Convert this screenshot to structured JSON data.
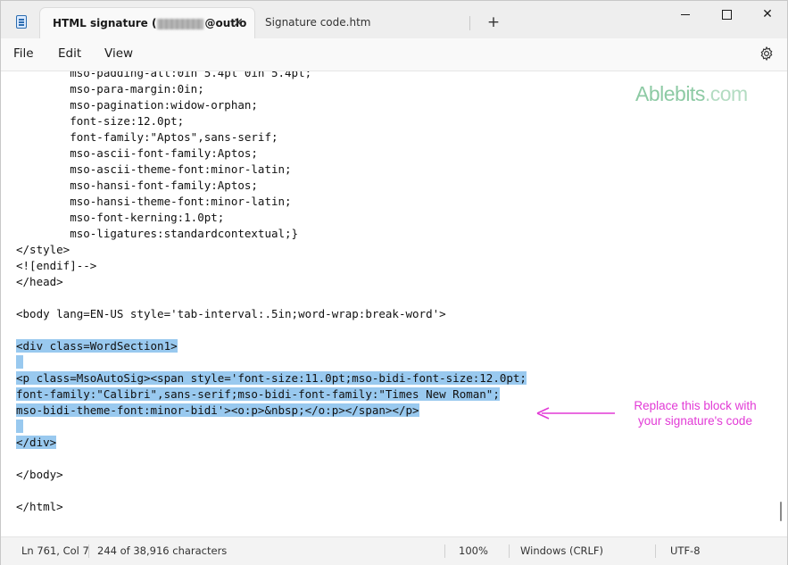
{
  "window": {
    "tabs": [
      {
        "label_prefix": "HTML signature (",
        "label_suffix": "@outlo",
        "active": true
      },
      {
        "label": "Signature code.htm",
        "active": false
      }
    ],
    "tab_close_glyph": "✕",
    "new_tab_glyph": "+",
    "close_glyph": "✕"
  },
  "menu": {
    "file": "File",
    "edit": "Edit",
    "view": "View"
  },
  "editor": {
    "lines": [
      {
        "text": "        mso-padding-alt:0in 5.4pt 0in 5.4pt;"
      },
      {
        "text": "        mso-para-margin:0in;"
      },
      {
        "text": "        mso-pagination:widow-orphan;"
      },
      {
        "text": "        font-size:12.0pt;"
      },
      {
        "text": "        font-family:\"Aptos\",sans-serif;"
      },
      {
        "text": "        mso-ascii-font-family:Aptos;"
      },
      {
        "text": "        mso-ascii-theme-font:minor-latin;"
      },
      {
        "text": "        mso-hansi-font-family:Aptos;"
      },
      {
        "text": "        mso-hansi-theme-font:minor-latin;"
      },
      {
        "text": "        mso-font-kerning:1.0pt;"
      },
      {
        "text": "        mso-ligatures:standardcontextual;}"
      },
      {
        "text": "</style>"
      },
      {
        "text": "<![endif]-->"
      },
      {
        "text": "</head>"
      },
      {
        "text": ""
      },
      {
        "text": "<body lang=EN-US style='tab-interval:.5in;word-wrap:break-word'>"
      },
      {
        "text": ""
      },
      {
        "text": "<div class=WordSection1>",
        "selected": true
      },
      {
        "text": " ",
        "selected": true
      },
      {
        "text": "<p class=MsoAutoSig><span style='font-size:11.0pt;mso-bidi-font-size:12.0pt;",
        "selected": true
      },
      {
        "text": "font-family:\"Calibri\",sans-serif;mso-bidi-font-family:\"Times New Roman\";",
        "selected": true
      },
      {
        "text": "mso-bidi-theme-font:minor-bidi'><o:p>&nbsp;</o:p></span></p>",
        "selected": true
      },
      {
        "text": " ",
        "selected": true
      },
      {
        "text": "</div>",
        "selected": true
      },
      {
        "text": ""
      },
      {
        "text": "</body>"
      },
      {
        "text": ""
      },
      {
        "text": "</html>"
      }
    ],
    "watermark": {
      "brand": "Ablebits",
      "suffix": ".com"
    },
    "callout": {
      "line1": "Replace this block with",
      "line2": "your signature's code",
      "color": "#e23ad6"
    },
    "selection_color": "#99c9ef"
  },
  "status": {
    "position": "Ln 761, Col 7",
    "characters": "244 of 38,916 characters",
    "zoom": "100%",
    "line_ending": "Windows (CRLF)",
    "encoding": "UTF-8"
  },
  "icons": {
    "app": "notepad-icon",
    "settings": "gear-icon",
    "minimize": "minimize-icon",
    "maximize": "maximize-icon",
    "close": "close-icon"
  }
}
